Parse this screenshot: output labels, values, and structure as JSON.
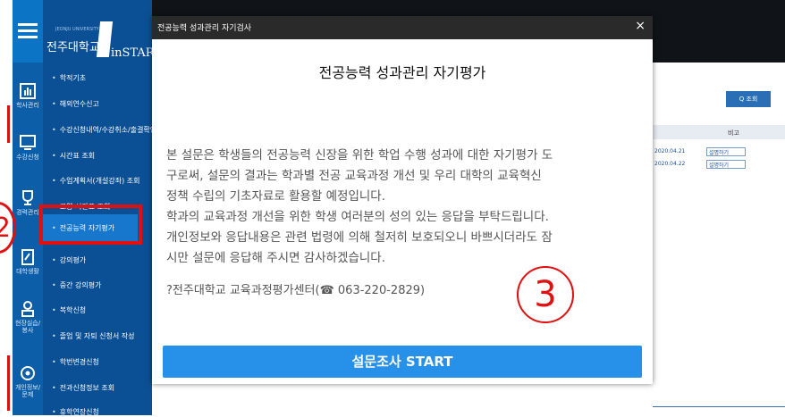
{
  "annotations": {
    "step2": "2",
    "step3": "3"
  },
  "brand": {
    "small": "JEONJU UNIVERSITY",
    "university": "전주대학교",
    "system": "inSTAR"
  },
  "rail": [
    {
      "label": "학사관리",
      "icon": "chart-icon"
    },
    {
      "label": "수강신청",
      "icon": "monitor-icon"
    },
    {
      "label": "경력관리",
      "icon": "trophy-icon"
    },
    {
      "label": "대학생활",
      "icon": "document-icon"
    },
    {
      "label": "현장실습/봉사",
      "icon": "person-icon"
    },
    {
      "label": "개인정보/문제",
      "icon": "gear-icon"
    }
  ],
  "menu": [
    "학적기초",
    "해외연수신고",
    "수강신청내역/수강취소/출결확인",
    "시간표 조회",
    "수업계획서(개설강좌) 조회",
    "교양 시간표 조회",
    "전공능력 자기평가",
    "강의평가",
    "중간 강의평가",
    "복학신청",
    "졸업 및 자퇴 신청서 작성",
    "학번변경신청",
    "전과신청정보 조회",
    "휴학연장신청"
  ],
  "background": {
    "search_label": "Q 조회",
    "col_header": "비고",
    "rows": [
      {
        "date": "2020.04.21",
        "button": "설명하기"
      },
      {
        "date": "2020.04.22",
        "button": "설명하기"
      }
    ]
  },
  "modal": {
    "header_title": "전공능력 성과관리 자기검사",
    "close": "×",
    "title": "전공능력 성과관리 자기평가",
    "body": [
      "본 설문은 학생들의 전공능력 신장을 위한 학업 수행 성과에 대한 자기평가 도",
      "구로써, 설문의 결과는 학과별 전공 교육과정 개선 및 우리 대학의 교육혁신",
      "정책 수립의 기초자료로 활용할 예정입니다.",
      "학과의 교육과정 개선을 위한 학생 여러분의 성의 있는 응답을 부탁드립니다.",
      "개인정보와 응답내용은 관련 법령에 의해 철저히 보호되오니 바쁘시더라도 잠",
      "시만 설문에 응답해 주시면 감사하겠습니다."
    ],
    "contact": "?전주대학교 교육과정평가센터(☎ 063-220-2829)",
    "start_button": "설문조사 START"
  }
}
